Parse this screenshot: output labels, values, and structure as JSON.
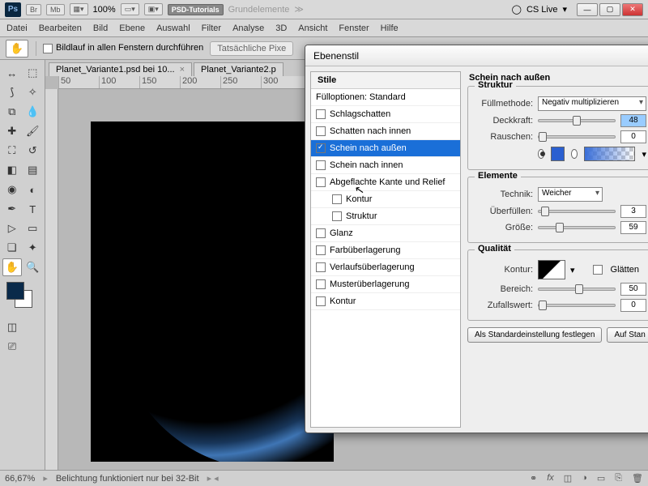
{
  "app": {
    "ps": "Ps",
    "br": "Br",
    "mb": "Mb",
    "zoom": "100%",
    "workspace_btn": "PSD-Tutorials",
    "workspace_btn2": "Grundelemente",
    "cslive": "CS Live"
  },
  "menu": {
    "datei": "Datei",
    "bearbeiten": "Bearbeiten",
    "bild": "Bild",
    "ebene": "Ebene",
    "auswahl": "Auswahl",
    "filter": "Filter",
    "analyse": "Analyse",
    "dd": "3D",
    "ansicht": "Ansicht",
    "fenster": "Fenster",
    "hilfe": "Hilfe"
  },
  "optbar": {
    "scroll_all": "Bildlauf in allen Fenstern durchführen",
    "actual": "Tatsächliche Pixe"
  },
  "tabs": {
    "t1": "Planet_Variante1.psd bei 10...",
    "t2": "Planet_Variante2.p",
    "x": "×"
  },
  "ruler": [
    "50",
    "100",
    "150",
    "200",
    "250",
    "300"
  ],
  "status": {
    "zoom": "66,67%",
    "msg": "Belichtung funktioniert nur bei 32-Bit"
  },
  "dialog": {
    "title": "Ebenenstil",
    "styles_hdr": "Stile",
    "blend_opts": "Fülloptionen: Standard",
    "items": {
      "schlagschatten": "Schlagschatten",
      "schatten_innen": "Schatten nach innen",
      "schein_aussen": "Schein nach außen",
      "schein_innen": "Schein nach innen",
      "bevel": "Abgeflachte Kante und Relief",
      "kontur": "Kontur",
      "struktur": "Struktur",
      "glanz": "Glanz",
      "farbueber": "Farbüberlagerung",
      "verlaufueber": "Verlaufsüberlagerung",
      "musterueber": "Musterüberlagerung",
      "kontur2": "Kontur"
    },
    "outer_glow_hdr": "Schein nach außen",
    "struktur_hdr": "Struktur",
    "fuellmethode": "Füllmethode:",
    "fuellmethode_val": "Negativ multiplizieren",
    "deckkraft": "Deckkraft:",
    "deckkraft_val": "48",
    "rauschen": "Rauschen:",
    "rauschen_val": "0",
    "elemente_hdr": "Elemente",
    "technik": "Technik:",
    "technik_val": "Weicher",
    "ueberfuellen": "Überfüllen:",
    "ueberfuellen_val": "3",
    "groesse": "Größe:",
    "groesse_val": "59",
    "qualitaet_hdr": "Qualität",
    "kontur_lbl": "Kontur:",
    "glaetten": "Glätten",
    "bereich": "Bereich:",
    "bereich_val": "50",
    "zufall": "Zufallswert:",
    "zufall_val": "0",
    "btn_default": "Als Standardeinstellung festlegen",
    "btn_reset": "Auf Stan"
  }
}
